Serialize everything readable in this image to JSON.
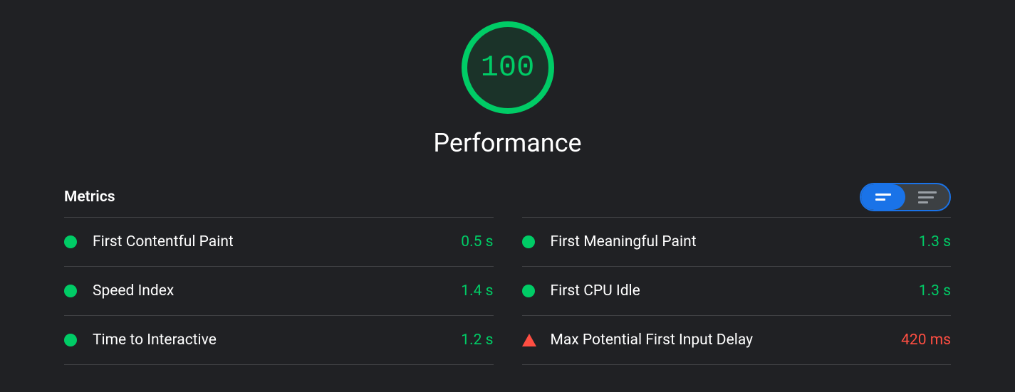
{
  "score": {
    "value": "100",
    "title": "Performance"
  },
  "metrics_section": {
    "title": "Metrics"
  },
  "metrics": {
    "left": [
      {
        "label": "First Contentful Paint",
        "value": "0.5 s",
        "status": "pass"
      },
      {
        "label": "Speed Index",
        "value": "1.4 s",
        "status": "pass"
      },
      {
        "label": "Time to Interactive",
        "value": "1.2 s",
        "status": "pass"
      }
    ],
    "right": [
      {
        "label": "First Meaningful Paint",
        "value": "1.3 s",
        "status": "pass"
      },
      {
        "label": "First CPU Idle",
        "value": "1.3 s",
        "status": "pass"
      },
      {
        "label": "Max Potential First Input Delay",
        "value": "420 ms",
        "status": "fail"
      }
    ]
  },
  "colors": {
    "pass": "#00cc66",
    "fail": "#ff4e42",
    "accent": "#1a73e8",
    "background": "#202124"
  }
}
